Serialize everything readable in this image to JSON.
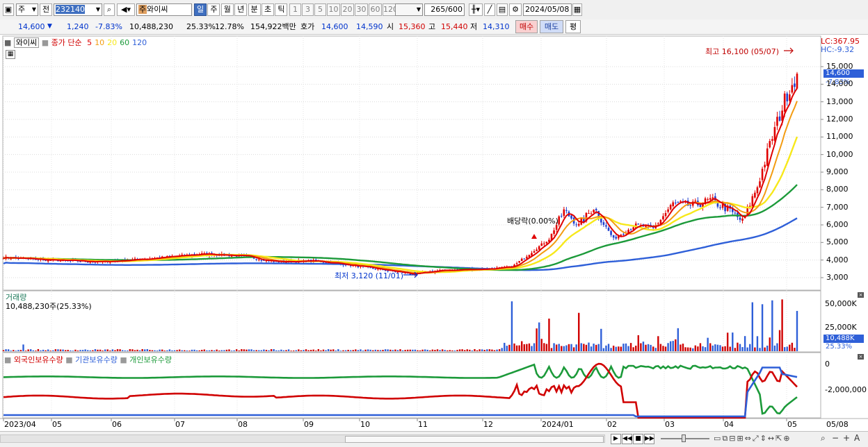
{
  "toolbar": {
    "market": "주",
    "prev_label": "전",
    "code": "232140",
    "name": "와이씨",
    "name_tag": "주",
    "periods": [
      "일",
      "주",
      "월",
      "년",
      "분",
      "초",
      "틱"
    ],
    "active_period": "일",
    "intervals": [
      "1",
      "3",
      "5",
      "10",
      "20",
      "30",
      "60",
      "120"
    ],
    "count": "265",
    "count_total": "/600",
    "date": "2024/05/08"
  },
  "quote": {
    "price": "14,600",
    "change": "1,240",
    "change_pct": "-7.83%",
    "volume": "10,488,230",
    "turnover_pct": "25.33%",
    "ratio": "12.78%",
    "amount": "154,922백만",
    "bid_label": "호가",
    "ask": "14,600",
    "bid": "14,590",
    "open_label": "시",
    "open": "15,360",
    "high_label": "고",
    "high": "15,440",
    "low_label": "저",
    "low": "14,310",
    "buy_label": "매수",
    "sell_label": "매도",
    "avg_label": "평",
    "colors": {
      "down": "#0033cc",
      "up": "#d00000"
    }
  },
  "price_panel": {
    "name_label": "와이씨",
    "legend_prefix": "종가 단순",
    "ma_periods": [
      "5",
      "10",
      "20",
      "60",
      "120"
    ],
    "ma_colors": [
      "#e00000",
      "#f39c12",
      "#f7e81a",
      "#1c9a3a",
      "#2e5fd8"
    ],
    "lc": "LC:367.95",
    "hc": "HC:-9.32",
    "max_note": "최고 16,100 (05/07)",
    "min_note": "최저 3,120 (11/01)",
    "dividend_note": "배당락(0.00%)",
    "current_tag": "14,600",
    "current_pct": "-7.83%",
    "y_ticks": [
      "15,000",
      "14,000",
      "13,000",
      "12,000",
      "11,000",
      "10,000",
      "9,000",
      "8,000",
      "7,000",
      "6,000",
      "5,000",
      "4,000",
      "3,000"
    ]
  },
  "volume_panel": {
    "title": "거래량",
    "value": "10,488,230주(25.33%)",
    "y_ticks": [
      "50,000K",
      "25,000K"
    ],
    "current_tag": "10,488K",
    "current_pct": "25.33%"
  },
  "holding_panel": {
    "series": [
      "외국인보유수량",
      "기관보유수량",
      "개인보유수량"
    ],
    "series_colors": [
      "#d00000",
      "#2e5fd8",
      "#1c9a3a"
    ],
    "y_ticks": [
      "0",
      "-2,000,000"
    ]
  },
  "x_axis": {
    "labels": [
      "2023/04",
      "05",
      "06",
      "07",
      "08",
      "09",
      "10",
      "11",
      "12",
      "2024/01",
      "02",
      "03",
      "04",
      "05"
    ],
    "right_label": "05/08"
  },
  "chart_data": {
    "type": "candlestick",
    "ylim": [
      2600,
      16300
    ],
    "key_points": [
      {
        "x": "11/01",
        "y": 3120,
        "label": "최저 3,120 (11/01)"
      },
      {
        "x": "05/07",
        "y": 16100,
        "label": "최고 16,100 (05/07)"
      }
    ],
    "anchors": [
      [
        0,
        4150
      ],
      [
        18,
        4000
      ],
      [
        40,
        3900
      ],
      [
        60,
        4100
      ],
      [
        80,
        4350
      ],
      [
        95,
        4250
      ],
      [
        110,
        3900
      ],
      [
        125,
        3950
      ],
      [
        135,
        3800
      ],
      [
        150,
        3500
      ],
      [
        165,
        3200
      ],
      [
        175,
        3400
      ],
      [
        195,
        3500
      ],
      [
        205,
        3600
      ],
      [
        220,
        5200
      ],
      [
        226,
        6800
      ],
      [
        232,
        6000
      ],
      [
        238,
        7000
      ],
      [
        246,
        5200
      ],
      [
        255,
        6000
      ],
      [
        262,
        5800
      ],
      [
        270,
        7200
      ],
      [
        278,
        7100
      ],
      [
        285,
        7400
      ],
      [
        292,
        6900
      ],
      [
        298,
        6200
      ],
      [
        304,
        8200
      ],
      [
        310,
        11000
      ],
      [
        316,
        13500
      ],
      [
        320,
        14600
      ]
    ],
    "volume_spikes": [
      {
        "i": 8,
        "v": 7
      },
      {
        "i": 205,
        "v": 52
      },
      {
        "i": 216,
        "v": 30
      },
      {
        "i": 220,
        "v": 34
      },
      {
        "i": 232,
        "v": 40
      },
      {
        "i": 258,
        "v": 10
      },
      {
        "i": 272,
        "v": 24
      },
      {
        "i": 284,
        "v": 14
      },
      {
        "i": 302,
        "v": 51
      },
      {
        "i": 306,
        "v": 49
      },
      {
        "i": 310,
        "v": 53
      },
      {
        "i": 314,
        "v": 54
      },
      {
        "i": 320,
        "v": 42
      }
    ]
  }
}
